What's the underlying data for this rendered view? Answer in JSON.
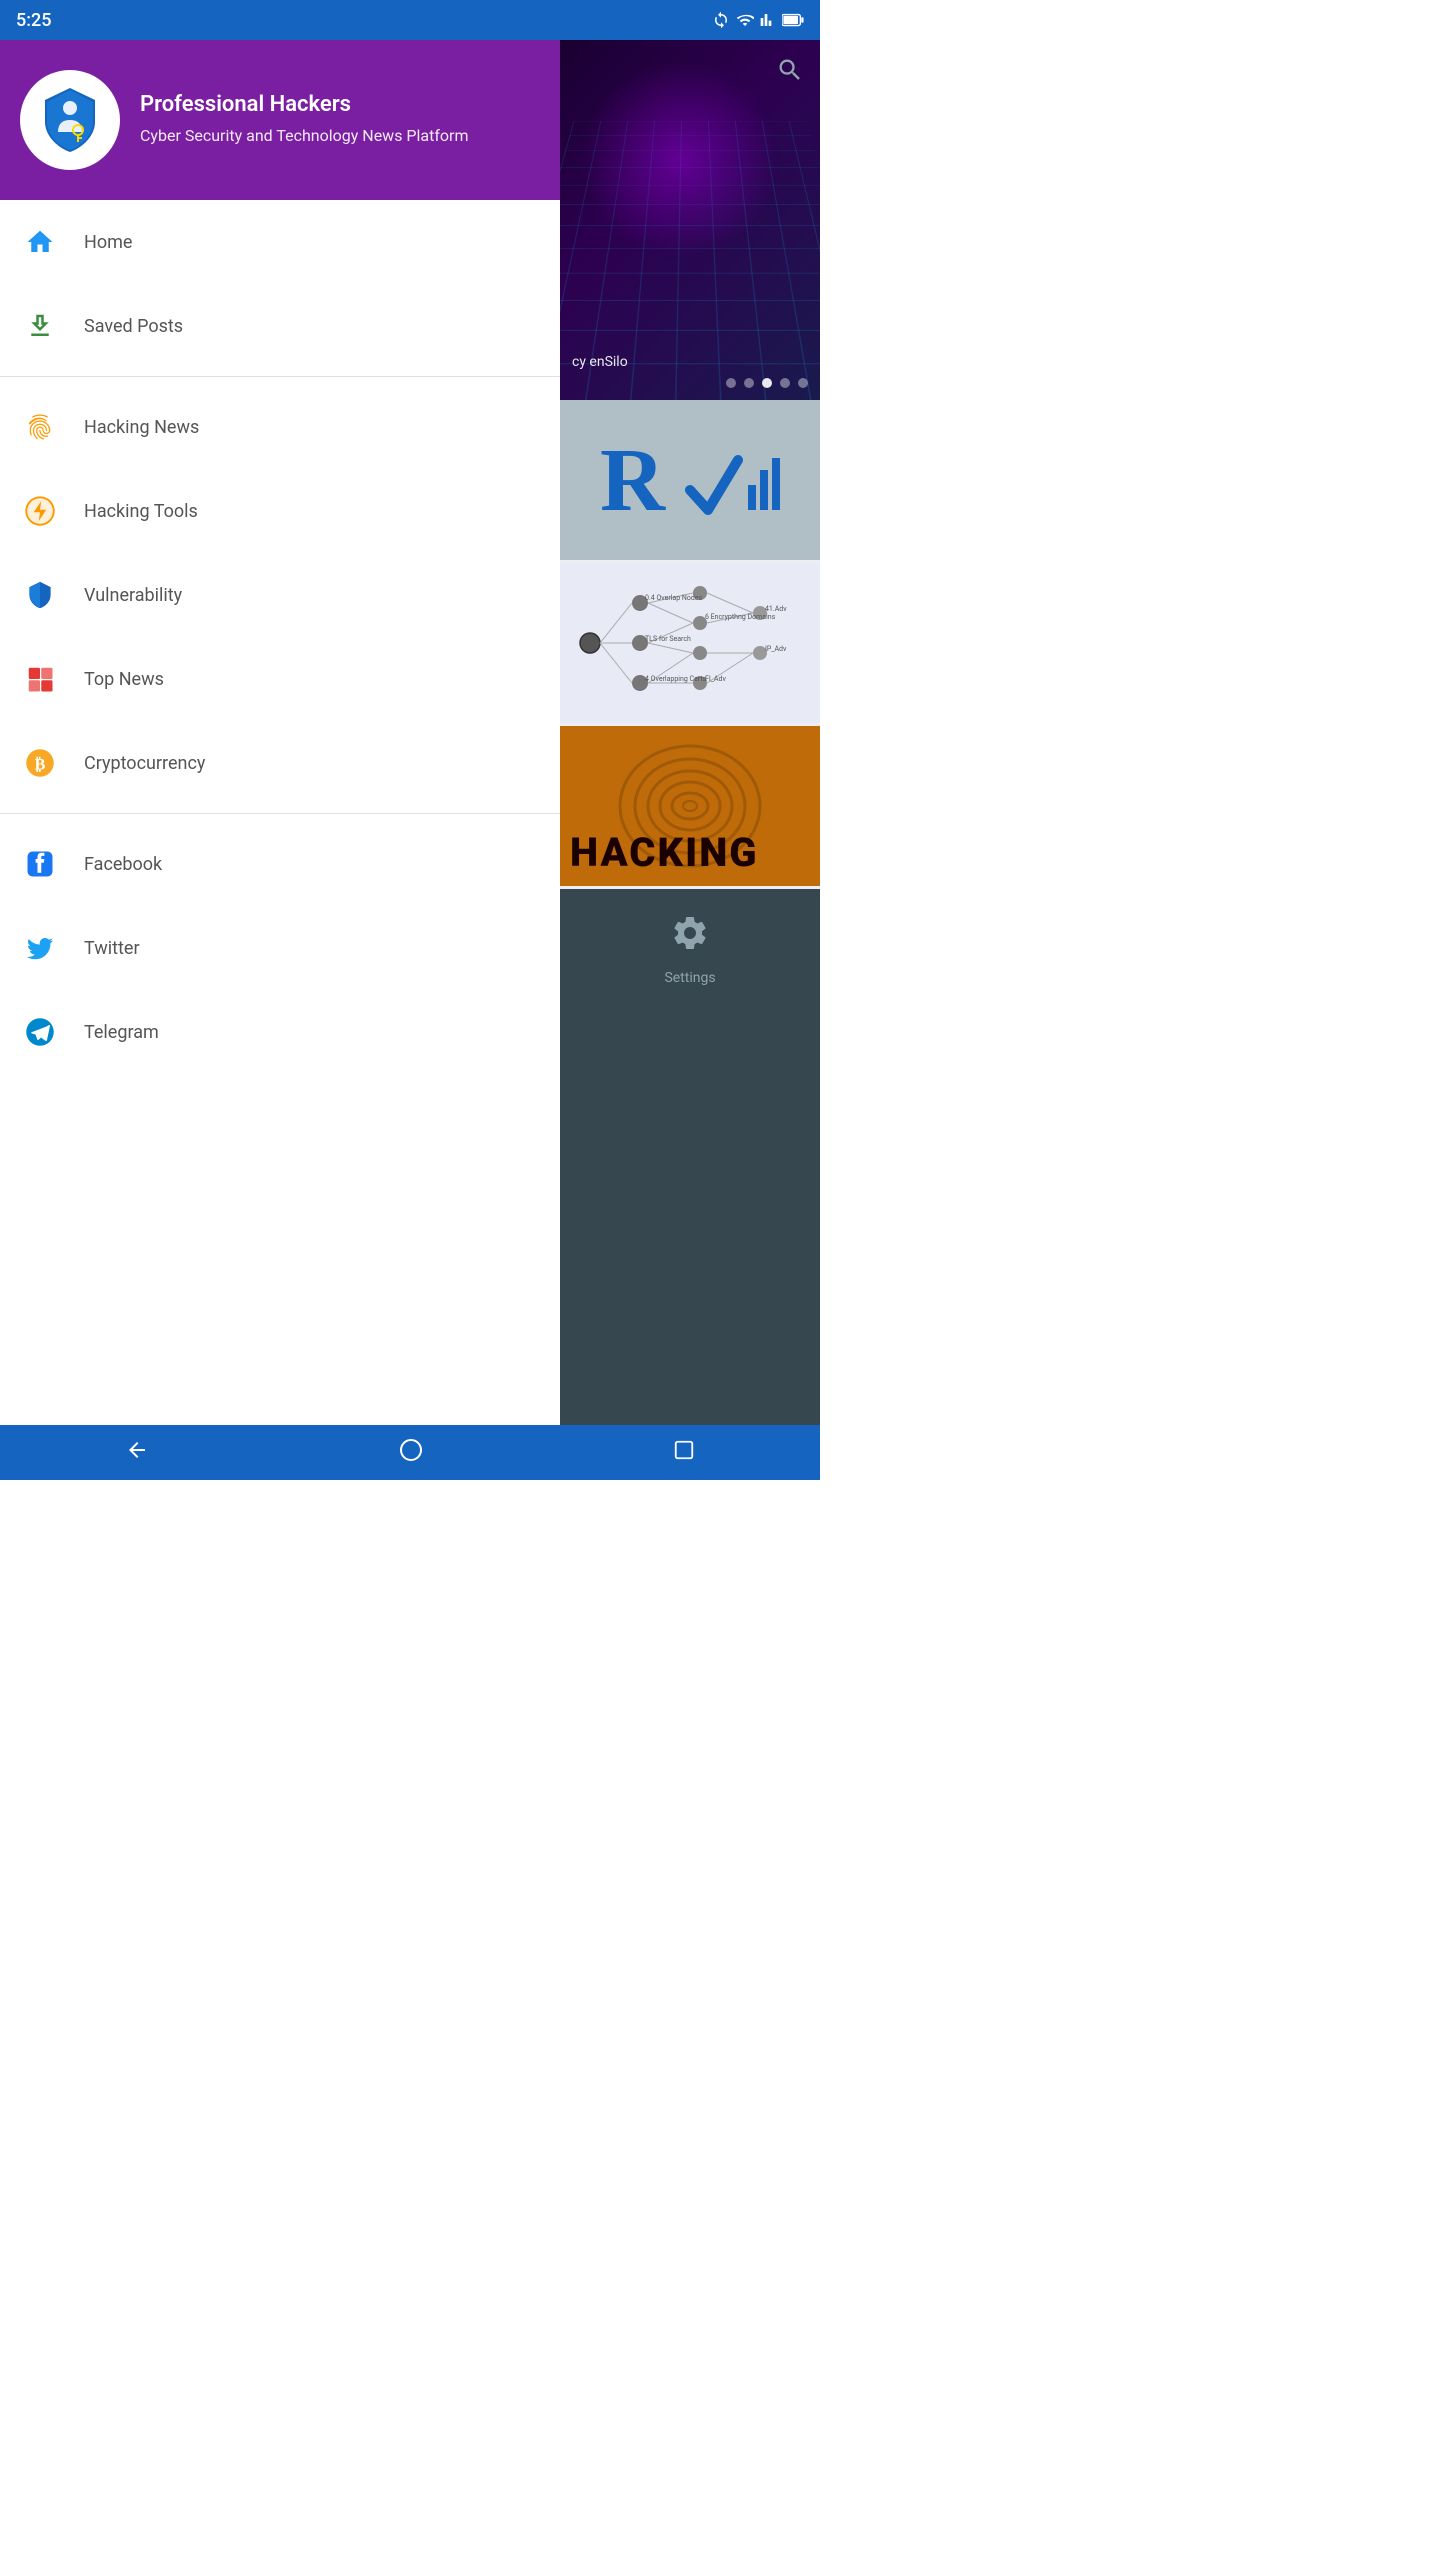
{
  "statusBar": {
    "time": "5:25",
    "icons": [
      "sync-icon",
      "wifi-icon",
      "signal-icon",
      "battery-icon"
    ]
  },
  "drawer": {
    "header": {
      "appName": "Professional Hackers",
      "subtitle": "Cyber Security and Technology News Platform"
    },
    "sections": [
      {
        "items": [
          {
            "id": "home",
            "label": "Home",
            "icon": "home-icon",
            "iconColor": "#2196F3"
          },
          {
            "id": "saved-posts",
            "label": "Saved Posts",
            "icon": "save-icon",
            "iconColor": "#388E3C"
          }
        ]
      },
      {
        "items": [
          {
            "id": "hacking-news",
            "label": "Hacking News",
            "icon": "fingerprint-icon",
            "iconColor": "#FF9800"
          },
          {
            "id": "hacking-tools",
            "label": "Hacking Tools",
            "icon": "lightning-icon",
            "iconColor": "#FF9800"
          },
          {
            "id": "vulnerability",
            "label": "Vulnerability",
            "icon": "shield-icon",
            "iconColor": "#2196F3"
          },
          {
            "id": "top-news",
            "label": "Top News",
            "icon": "grid-icon",
            "iconColor": "#E53935"
          },
          {
            "id": "cryptocurrency",
            "label": "Cryptocurrency",
            "icon": "bitcoin-icon",
            "iconColor": "#F9A825"
          }
        ]
      },
      {
        "items": [
          {
            "id": "facebook",
            "label": "Facebook",
            "icon": "facebook-icon",
            "iconColor": "#1877F2"
          },
          {
            "id": "twitter",
            "label": "Twitter",
            "icon": "twitter-icon",
            "iconColor": "#1DA1F2"
          },
          {
            "id": "telegram",
            "label": "Telegram",
            "icon": "telegram-icon",
            "iconColor": "#0088cc"
          }
        ]
      }
    ]
  },
  "rightPanel": {
    "heroLabel": "cy enSilo",
    "sliderDots": [
      false,
      false,
      true,
      false,
      false
    ],
    "cards": [
      {
        "type": "rt-logo"
      },
      {
        "type": "diagram"
      },
      {
        "type": "hacking",
        "text": "HACKING"
      },
      {
        "type": "settings",
        "label": "Settings"
      }
    ]
  },
  "bottomNav": {
    "buttons": [
      "back-icon",
      "home-circle-icon",
      "square-icon"
    ]
  }
}
